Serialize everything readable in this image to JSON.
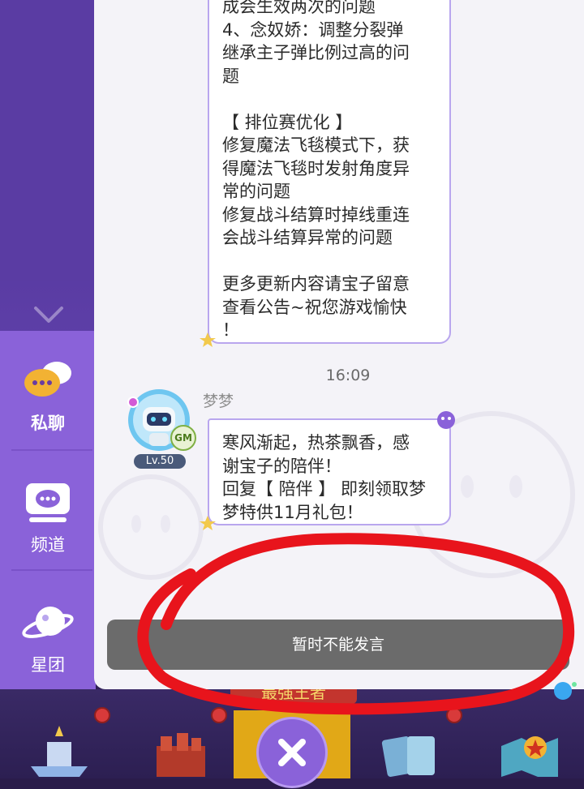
{
  "chat": {
    "message1": {
      "lines": [
        "成会生效两次的问题",
        "4、念奴娇：调整分裂弹",
        "继承主子弹比例过高的问",
        "题",
        "",
        "【 排位赛优化 】",
        "修复魔法飞毯模式下，获",
        "得魔法飞毯时发射角度异",
        "常的问题",
        "修复战斗结算时掉线重连",
        "会战斗结算异常的问题",
        "",
        "更多更新内容请宝子留意",
        "查看公告~祝您游戏愉快",
        "！"
      ]
    },
    "time": "16:09",
    "sender": {
      "name": "梦梦",
      "level": "Lv.50",
      "role_badge": "GM"
    },
    "message2": {
      "lines": [
        "寒风渐起，热茶飘香，感",
        "谢宝子的陪伴！",
        "回复【 陪伴 】 即刻领取梦",
        "梦特供11月礼包！"
      ]
    },
    "input_disabled_text": "暂时不能发言"
  },
  "sidebar": {
    "items": [
      {
        "label": "私聊",
        "icon": "private-chat-icon"
      },
      {
        "label": "频道",
        "icon": "channel-icon"
      },
      {
        "label": "星团",
        "icon": "planet-icon"
      }
    ]
  },
  "banner_text": "最强王者",
  "colors": {
    "sidebar_purple": "#8a62d9",
    "bubble_border": "#b9a6ee",
    "disabled_input": "#6b6b6b",
    "annotation_red": "#e8141c"
  }
}
